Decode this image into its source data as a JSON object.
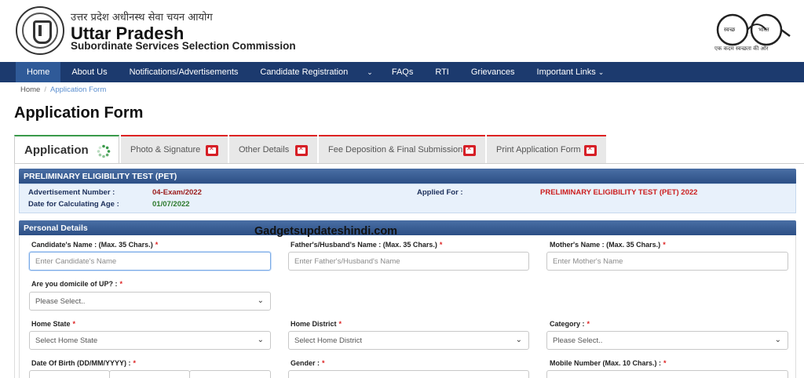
{
  "header": {
    "org_hindi": "उत्तर प्रदेश अधीनस्थ सेवा चयन आयोग",
    "org_name": "Uttar Pradesh",
    "org_subtitle": "Subordinate Services Selection Commission",
    "swachh_tagline": "एक कदम स्वच्छता की ओर",
    "swachh_word1": "स्वच्छ",
    "swachh_word2": "भारत"
  },
  "nav": {
    "items": [
      {
        "label": "Home"
      },
      {
        "label": "About Us"
      },
      {
        "label": "Notifications/Advertisements"
      },
      {
        "label": "Candidate Registration"
      },
      {
        "label": "FAQs"
      },
      {
        "label": "RTI"
      },
      {
        "label": "Grievances"
      },
      {
        "label": "Important Links"
      }
    ],
    "caret": "⌄"
  },
  "breadcrumb": {
    "home": "Home",
    "sep": "/",
    "current": "Application Form"
  },
  "page_title": "Application Form",
  "tabs": [
    {
      "label": "Application"
    },
    {
      "label": "Photo & Signature"
    },
    {
      "label": "Other Details"
    },
    {
      "label": "Fee Deposition & Final Submission"
    },
    {
      "label": "Print Application Form"
    }
  ],
  "exam_panel": {
    "title": "PRELIMINARY ELIGIBILITY TEST (PET)",
    "adv_label": "Advertisement Number :",
    "adv_value": "04-Exam/2022",
    "age_label": "Date for Calculating Age :",
    "age_value": "01/07/2022",
    "applied_label": "Applied For :",
    "applied_value": "PRELIMINARY ELIGIBILITY TEST (PET) 2022"
  },
  "watermark": "Gadgetsupdateshindi.com",
  "personal": {
    "title": "Personal Details",
    "name_label": "Candidate's Name : (Max. 35 Chars.)",
    "name_placeholder": "Enter Candidate's Name",
    "father_label": "Father's/Husband's Name : (Max. 35 Chars.)",
    "father_placeholder": "Enter Father's/Husband's Name",
    "mother_label": "Mother's Name : (Max. 35 Chars.)",
    "mother_placeholder": "Enter Mother's Name",
    "domicile_label": "Are you domicile of UP? :",
    "domicile_value": "Please Select..",
    "home_state_label": "Home State",
    "home_state_value": "Select Home State",
    "home_district_label": "Home District",
    "home_district_value": "Select Home District",
    "category_label": "Category :",
    "category_value": "Please Select..",
    "dob_label": "Date Of Birth (DD/MM/YYYY) :",
    "gender_label": "Gender :",
    "mobile_label": "Mobile Number (Max. 10 Chars.) :",
    "required_mark": "*"
  }
}
